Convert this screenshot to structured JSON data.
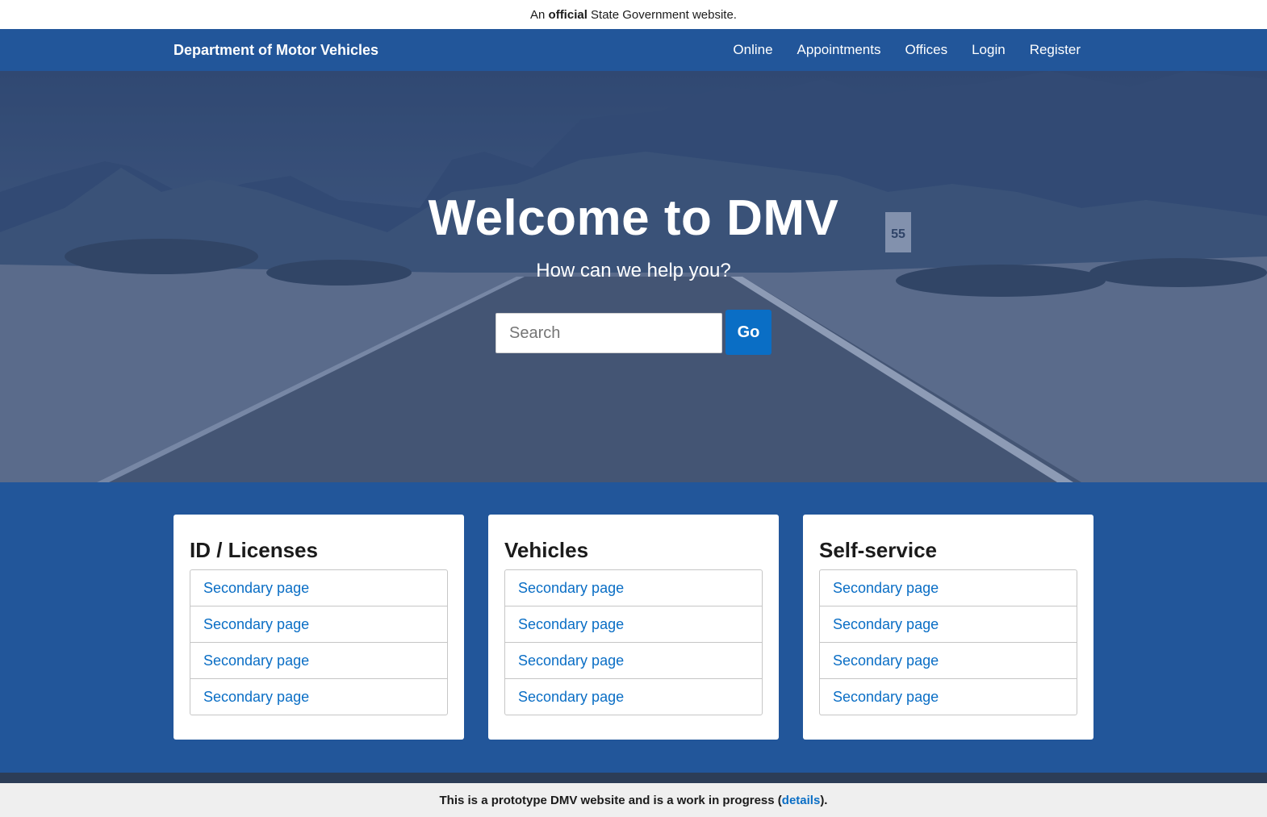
{
  "gov_banner": {
    "prefix": "An",
    "emphasis": "official",
    "suffix": "State Government website."
  },
  "header": {
    "brand": "Department of Motor Vehicles",
    "nav": [
      "Online",
      "Appointments",
      "Offices",
      "Login",
      "Register"
    ]
  },
  "hero": {
    "title": "Welcome to DMV",
    "subtitle": "How can we help you?",
    "search_placeholder": "Search",
    "search_button": "Go"
  },
  "cards": [
    {
      "title": "ID / Licenses",
      "links": [
        "Secondary page",
        "Secondary page",
        "Secondary page",
        "Secondary page"
      ]
    },
    {
      "title": "Vehicles",
      "links": [
        "Secondary page",
        "Secondary page",
        "Secondary page",
        "Secondary page"
      ]
    },
    {
      "title": "Self-service",
      "links": [
        "Secondary page",
        "Secondary page",
        "Secondary page",
        "Secondary page"
      ]
    }
  ],
  "footer_note": {
    "text": "This is a prototype DMV website and is a work in progress (",
    "link": "details",
    "end": ")."
  },
  "colors": {
    "primary": "#22569a",
    "link": "#0a6ec5",
    "footer_bg": "#efefef"
  }
}
